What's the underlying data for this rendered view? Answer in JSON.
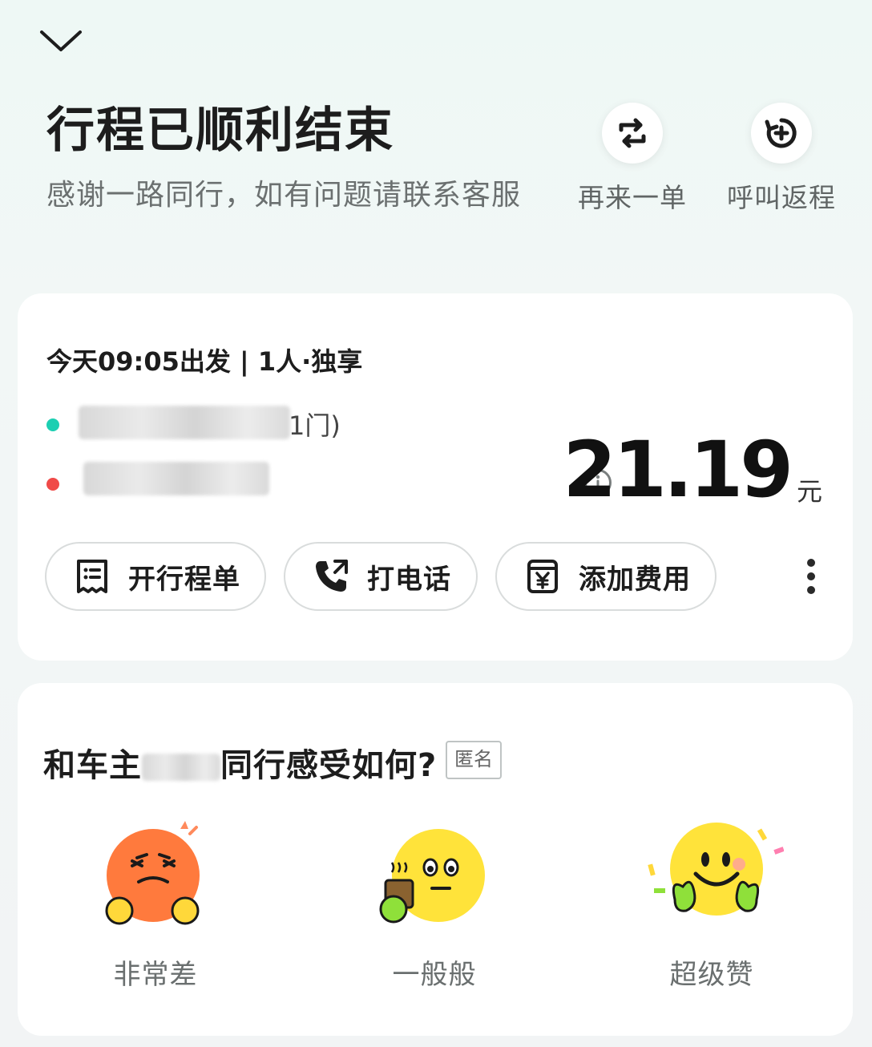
{
  "header": {
    "title": "行程已顺利结束",
    "subtitle": "感谢一路同行，如有问题请联系客服"
  },
  "quick_actions": [
    {
      "label": "再来一单",
      "icon": "repeat-icon"
    },
    {
      "label": "呼叫返程",
      "icon": "return-trip-icon"
    }
  ],
  "trip": {
    "meta": "今天09:05出发 | 1人·独享",
    "pickup": {
      "tail": "1门)",
      "dot_color": "#1ccfb2"
    },
    "dropoff": {
      "dot_color": "#f04a48"
    },
    "fare": "21.19",
    "currency": "元",
    "actions": [
      {
        "label": "开行程单",
        "icon": "receipt-icon"
      },
      {
        "label": "打电话",
        "icon": "phone-icon"
      },
      {
        "label": "添加费用",
        "icon": "add-fee-icon"
      }
    ]
  },
  "rating": {
    "question_prefix": "和车主",
    "question_suffix": "同行感受如何?",
    "anonymous_badge": "匿名",
    "options": [
      {
        "label": "非常差",
        "icon": "angry-face-icon"
      },
      {
        "label": "一般般",
        "icon": "neutral-face-icon"
      },
      {
        "label": "超级赞",
        "icon": "happy-face-icon"
      }
    ]
  },
  "colors": {
    "accent_teal": "#1ccfb2",
    "accent_red": "#f04a48"
  }
}
